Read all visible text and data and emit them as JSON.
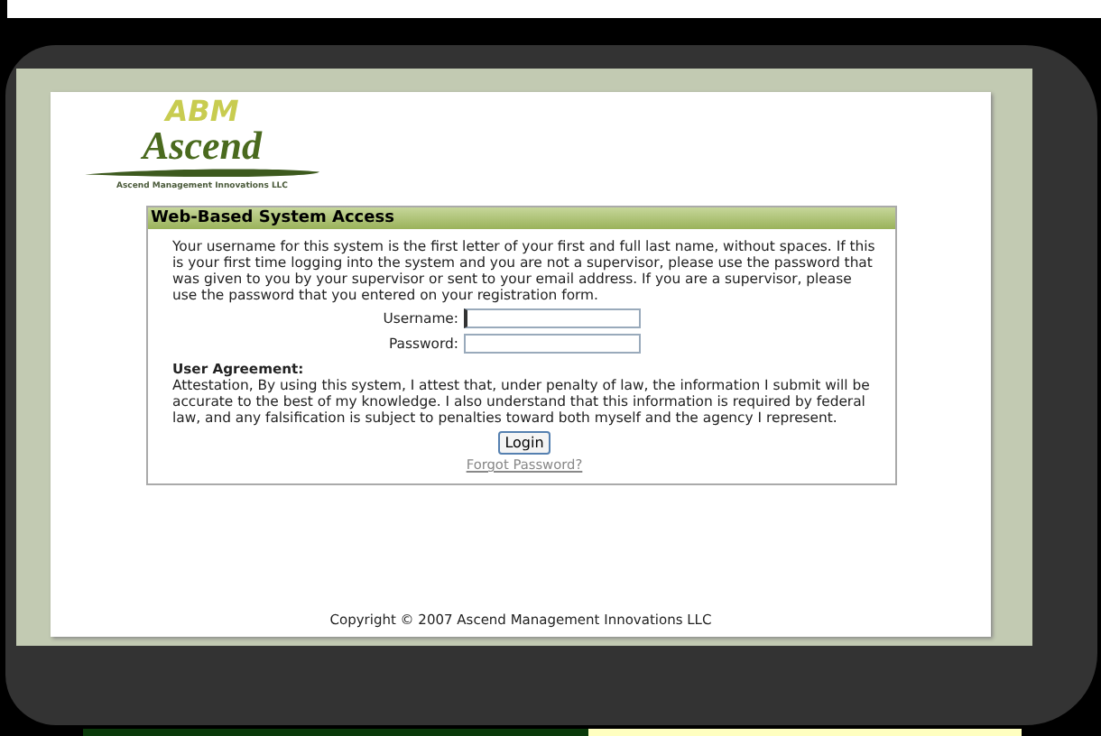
{
  "logo": {
    "letters": "ABM",
    "name": "Ascend",
    "tagline": "Ascend Management Innovations LLC"
  },
  "panel": {
    "title": "Web-Based System Access",
    "instructions": "Your username for this system is the first letter of your first and full last name, without spaces. If this is your first time logging into the system and you are not a supervisor, please use the password that was given to you by your supervisor or sent to your email address. If you are a supervisor, please use the password that you entered on your registration form.",
    "fields": [
      {
        "label": "Username:",
        "focused": true
      },
      {
        "label": "Password:",
        "focused": false
      }
    ],
    "agreement_title": "User Agreement:",
    "agreement": "Attestation, By using this system, I attest that, under penalty of law, the information I submit will be accurate to the best of my knowledge. I also understand that this information is required by federal law, and any falsification is subject to penalties toward both myself and the agency I represent.",
    "login_button": "Login",
    "forgot_link": "Forgot Password?"
  },
  "footer": "Copyright © 2007 Ascend Management Innovations LLC"
}
